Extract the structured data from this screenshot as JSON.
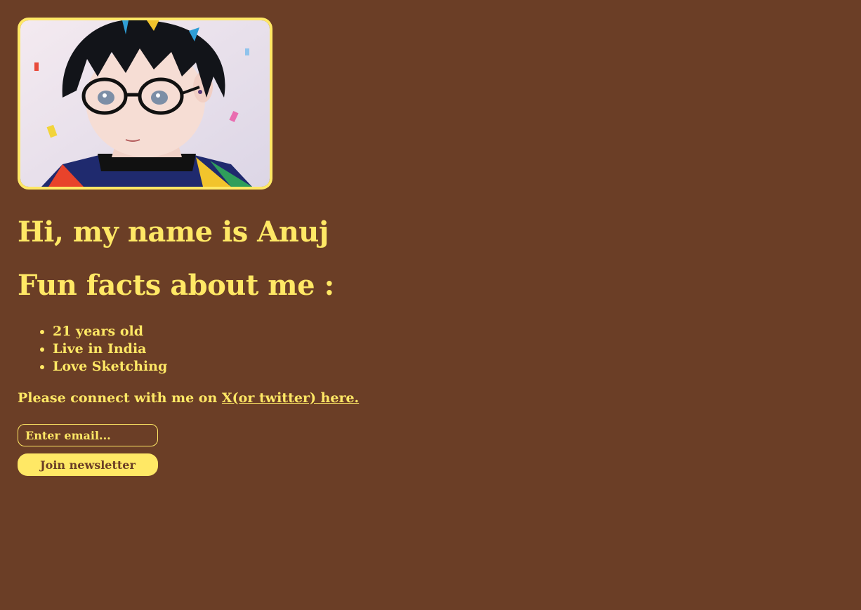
{
  "profile": {
    "avatar_icon": "anime-portrait-image",
    "heading": "Hi, my name is Anuj",
    "facts_heading": "Fun facts about me :",
    "facts": [
      "21 years old",
      "Live in India",
      "Love Sketching"
    ],
    "connect_text": "Please connect with me on ",
    "connect_link": "X(or twitter) here."
  },
  "newsletter": {
    "email_placeholder": "Enter email...",
    "email_value": "",
    "join_label": "Join newsletter"
  },
  "colors": {
    "background": "#6b3e26",
    "accent": "#ffe865"
  }
}
